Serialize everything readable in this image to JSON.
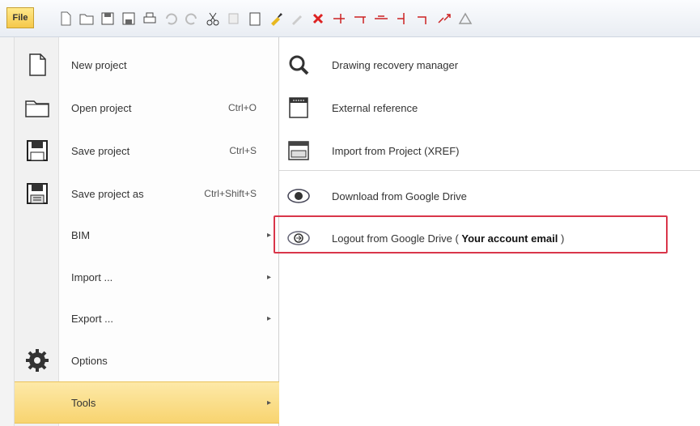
{
  "toolbar": {
    "file_label": "File",
    "icons": [
      "new-file-icon",
      "open-folder-icon",
      "save-icon",
      "save-as-icon",
      "print-icon",
      "undo-icon",
      "redo-icon",
      "cut-icon",
      "copy-icon",
      "paste-icon",
      "brush-icon",
      "pencil-icon",
      "delete-x-icon",
      "line-tool-1-icon",
      "line-tool-2-icon",
      "line-tool-3-icon",
      "line-tool-4-icon",
      "line-tool-5-icon",
      "line-tool-6-icon",
      "triangle-tool-icon"
    ]
  },
  "left_menu": {
    "items": [
      {
        "label": "New project",
        "shortcut": "",
        "submenu": false
      },
      {
        "label": "Open project",
        "shortcut": "Ctrl+O",
        "submenu": false
      },
      {
        "label": "Save project",
        "shortcut": "Ctrl+S",
        "submenu": false
      },
      {
        "label": "Save project as",
        "shortcut": "Ctrl+Shift+S",
        "submenu": false
      },
      {
        "label": "BIM",
        "shortcut": "",
        "submenu": true
      },
      {
        "label": "Import ...",
        "shortcut": "",
        "submenu": true
      },
      {
        "label": "Export ...",
        "shortcut": "",
        "submenu": true
      },
      {
        "label": "Options",
        "shortcut": "",
        "submenu": false
      },
      {
        "label": "Tools",
        "shortcut": "",
        "submenu": true
      }
    ],
    "arrow": "▸"
  },
  "right_panel": {
    "items": [
      {
        "label": "Drawing recovery manager"
      },
      {
        "label": "External reference"
      },
      {
        "label": "Import from Project (XREF)"
      },
      {
        "label": "Download from Google Drive"
      },
      {
        "label_prefix": "Logout from Google Drive ( ",
        "label_bold": "Your account email",
        "label_suffix": " )"
      }
    ]
  },
  "colors": {
    "highlight_menu": "#f8d470",
    "callout_border": "#d9364a",
    "file_button": "#f5c84a"
  }
}
